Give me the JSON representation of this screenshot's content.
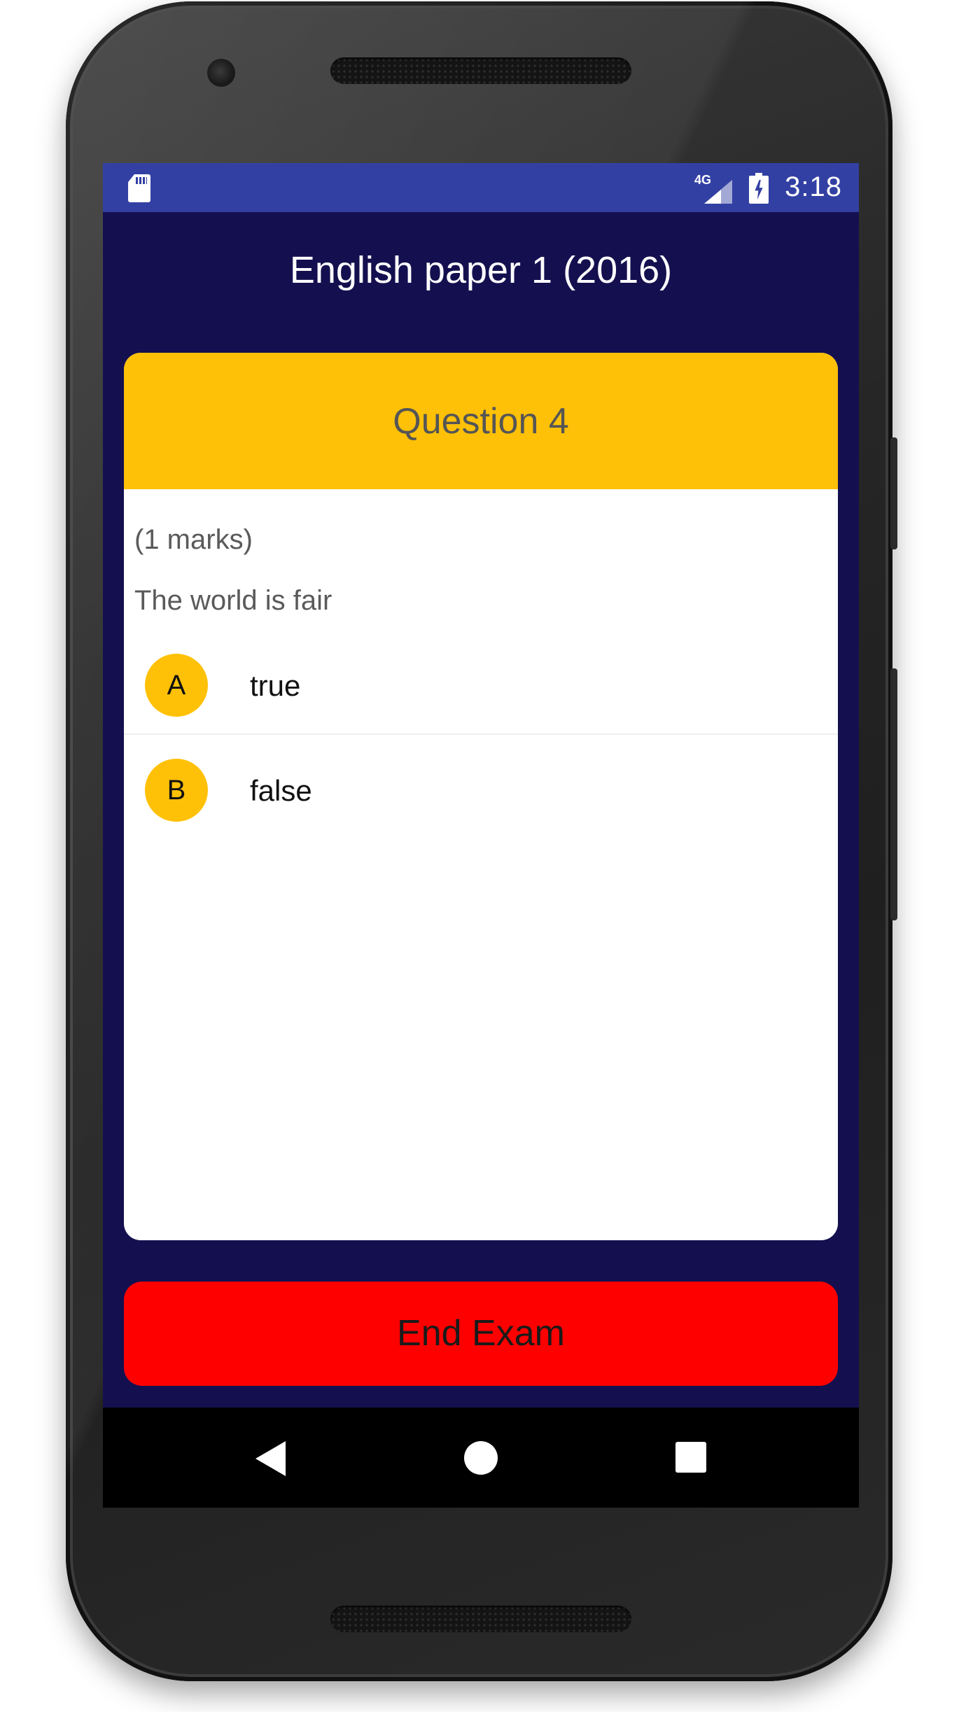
{
  "status_bar": {
    "network_label": "4G",
    "time": "3:18"
  },
  "app": {
    "title": "English paper 1 (2016)"
  },
  "question": {
    "header": "Question 4",
    "marks": "(1 marks)",
    "text": "The world is fair",
    "options": [
      {
        "letter": "A",
        "text": "true"
      },
      {
        "letter": "B",
        "text": "false"
      }
    ]
  },
  "actions": {
    "end_exam_label": "End Exam"
  },
  "icons": {
    "sd_card": "sd-card-icon",
    "signal": "signal-icon",
    "battery": "battery-charging-icon",
    "back": "back-icon",
    "home": "home-icon",
    "recents": "recents-icon"
  },
  "colors": {
    "status_bar": "#3340a3",
    "background": "#14104f",
    "accent": "#ffc107",
    "danger": "#ff0000"
  }
}
